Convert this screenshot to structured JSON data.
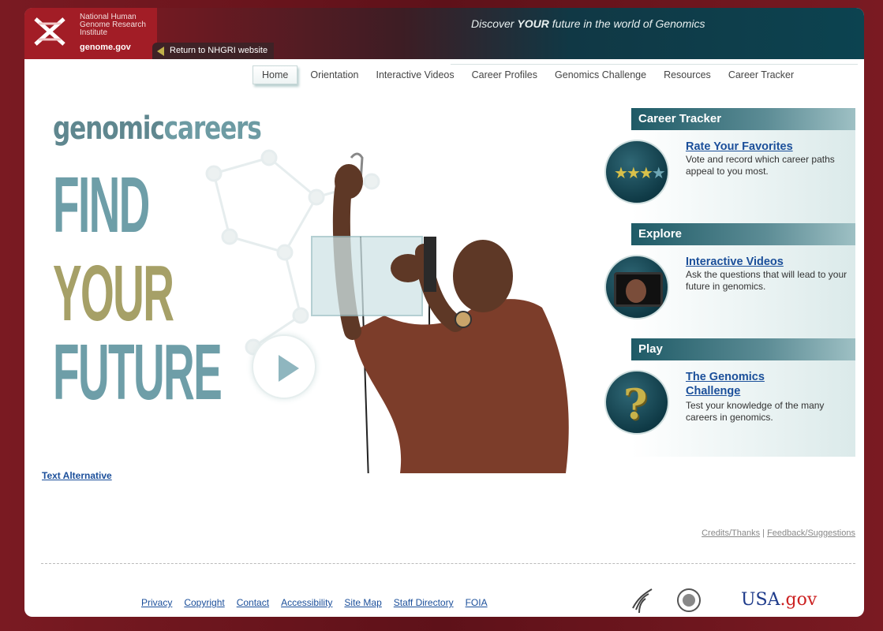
{
  "header": {
    "org_lines": [
      "National Human",
      "Genome Research",
      "Institute"
    ],
    "org_site": "genome.gov",
    "return_link": "Return to NHGRI website",
    "tagline_pre": "Discover ",
    "tagline_bold": "YOUR",
    "tagline_post": " future in the world of Genomics"
  },
  "nav": {
    "items": [
      "Home",
      "Orientation",
      "Interactive Videos",
      "Career Profiles",
      "Genomics Challenge",
      "Resources",
      "Career Tracker"
    ],
    "active": "Home"
  },
  "hero": {
    "brand_bold": "genomic",
    "brand_light": "careers",
    "line1": "FIND",
    "line2": "YOUR",
    "line3": "FUTURE",
    "text_alternative": "Text Alternative"
  },
  "panels": [
    {
      "heading": "Career Tracker",
      "link": "Rate Your Favorites",
      "desc": "Vote and record which career paths appeal to you most.",
      "icon": "stars-icon"
    },
    {
      "heading": "Explore",
      "link": "Interactive Videos",
      "desc": "Ask the questions that will lead to your future in genomics.",
      "icon": "video-tv-icon"
    },
    {
      "heading": "Play",
      "link": "The Genomics Challenge",
      "desc": "Test your knowledge of the many careers in genomics.",
      "icon": "question-mark-icon"
    }
  ],
  "footer": {
    "credits": "Credits/Thanks",
    "separator": "|",
    "feedback": "Feedback/Suggestions",
    "links": [
      "Privacy",
      "Copyright",
      "Contact",
      "Accessibility",
      "Site Map",
      "Staff Directory",
      "FOIA"
    ],
    "usa_pre": "USA",
    "usa_post": ".gov"
  },
  "colors": {
    "header_red": "#a21d26",
    "header_teal": "#0c4350",
    "accent_blue": "#1b4f9a",
    "hero_teal": "#6e9ea8",
    "hero_olive": "#a6a067"
  }
}
